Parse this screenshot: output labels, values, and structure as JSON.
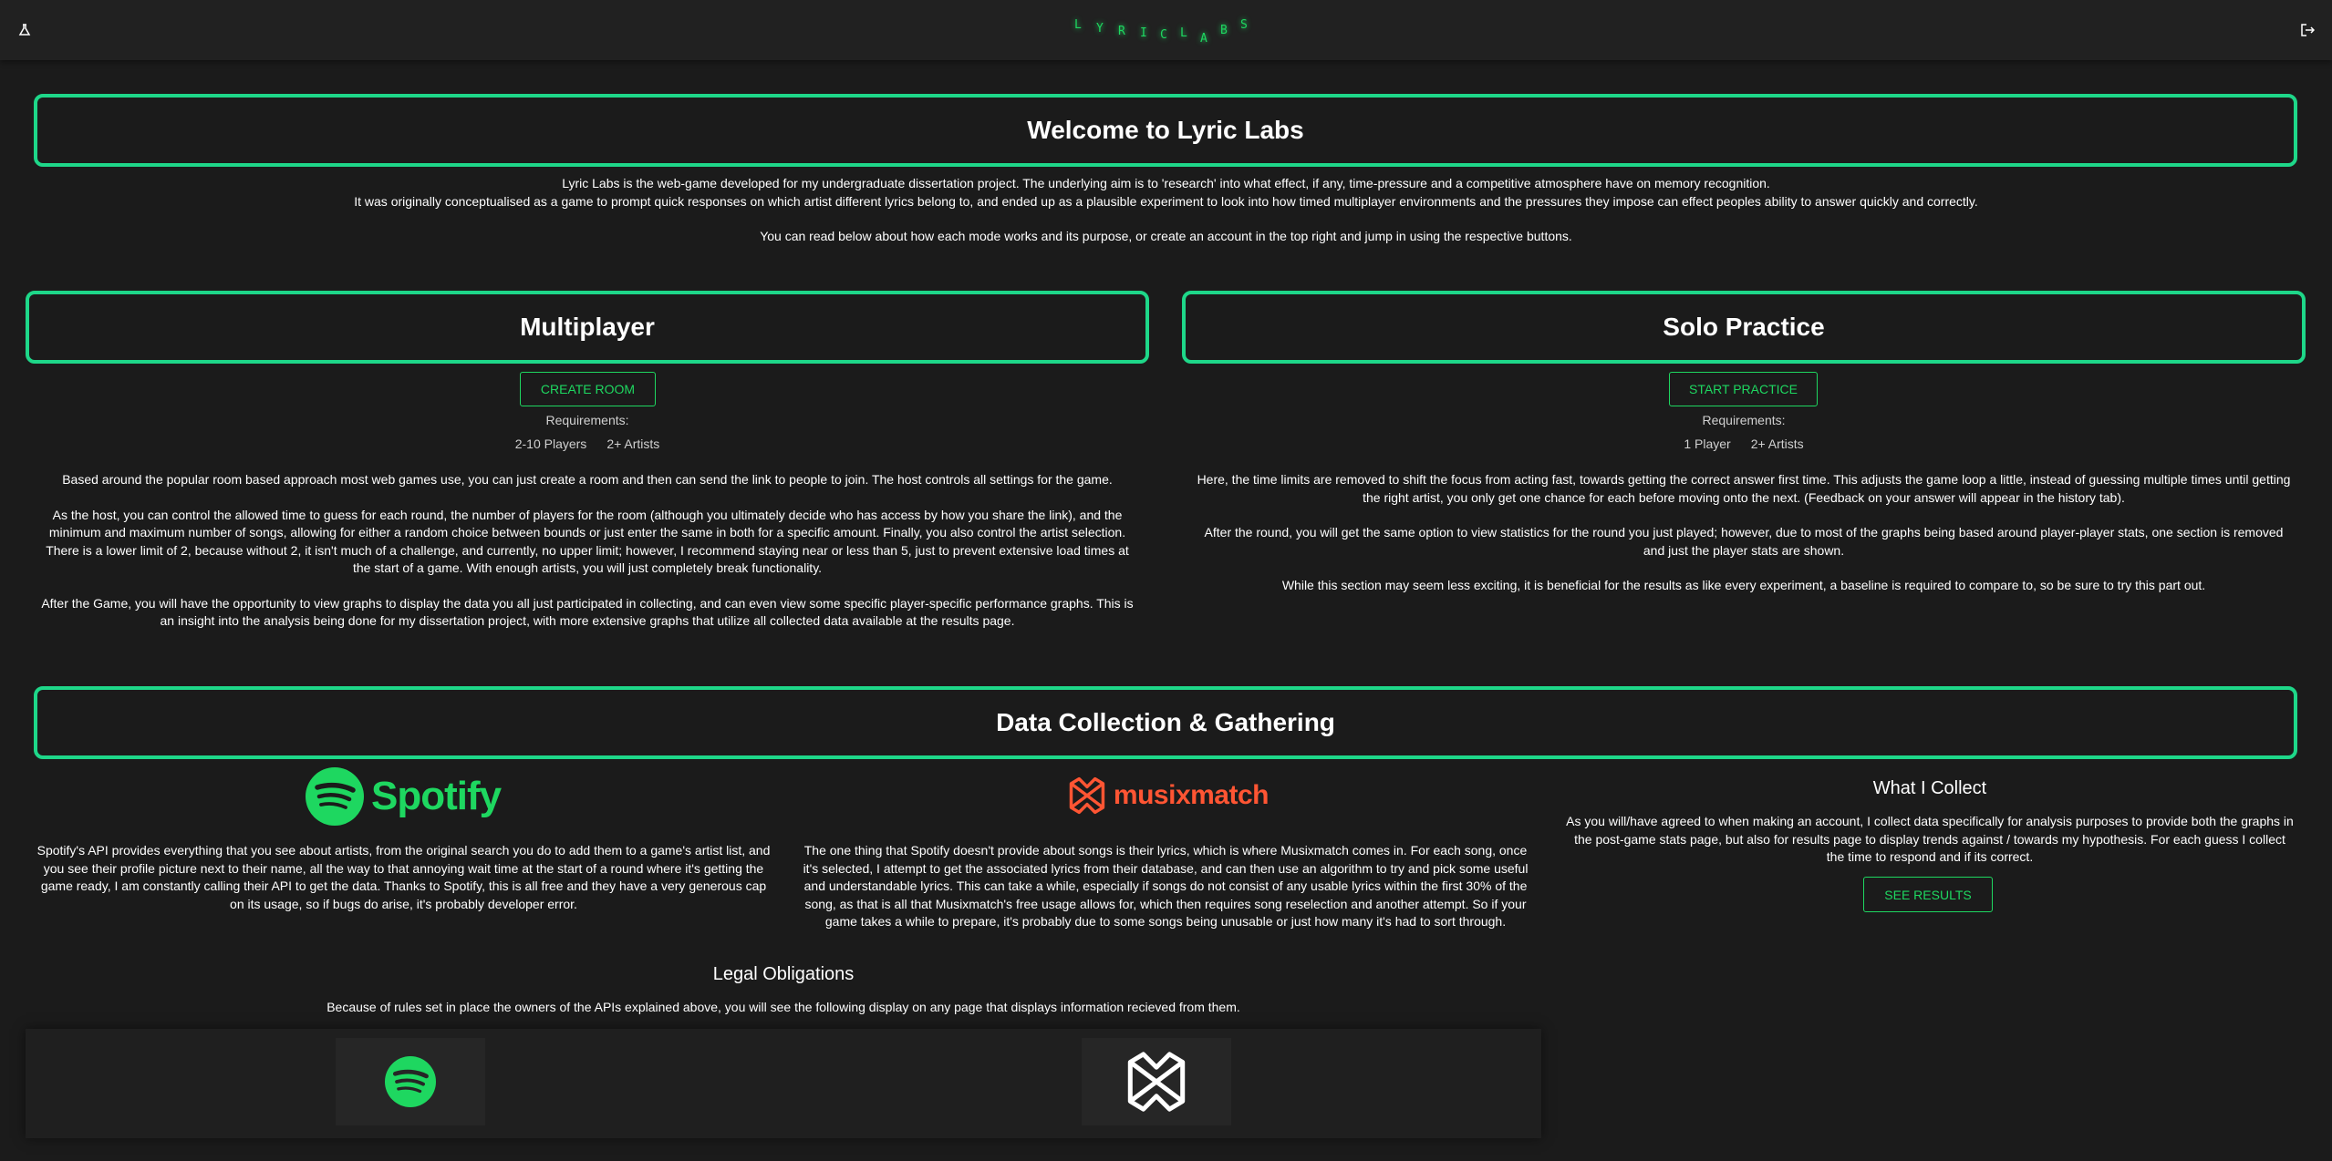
{
  "header": {
    "logo_letters": [
      "L",
      "Y",
      "R",
      "I",
      "C",
      "L",
      "A",
      "B",
      "S"
    ],
    "left_icon": "flask-icon",
    "right_icon": "logout-icon"
  },
  "welcome": {
    "title": "Welcome to Lyric Labs",
    "lines": [
      "Lyric Labs is the web-game developed for my undergraduate dissertation project. The underlying aim is to 'research' into what effect, if any, time-pressure and a competitive atmosphere have on memory recognition.",
      "It was originally conceptualised as a game to prompt quick responses on which artist different lyrics belong to, and ended up as a plausible experiment to look into how timed multiplayer environments and the pressures they impose can effect peoples ability to answer quickly and correctly.",
      "You can read below about how each mode works and its purpose, or create an account in the top right and jump in using the respective buttons."
    ]
  },
  "multiplayer": {
    "title": "Multiplayer",
    "button": "CREATE ROOM",
    "requirements_label": "Requirements:",
    "req_players": "2-10 Players",
    "req_artists": "2+ Artists",
    "paragraphs": [
      "Based around the popular room based approach most web games use, you can just create a room and then can send the link to people to join. The host controls all settings for the game.",
      "As the host, you can control the allowed time to guess for each round, the number of players for the room (although you ultimately decide who has access by how you share the link), and the minimum and maximum number of songs, allowing for either a random choice between bounds or just enter the same in both for a specific amount. Finally, you also control the artist selection. There is a lower limit of 2, because without 2, it isn't much of a challenge, and currently, no upper limit; however, I recommend staying near or less than 5, just to prevent extensive load times at the start of a game. With enough artists, you will just completely break functionality.",
      "After the Game, you will have the opportunity to view graphs to display the data you all just participated in collecting, and can even view some specific player-specific performance graphs. This is an insight into the analysis being done for my dissertation project, with more extensive graphs that utilize all collected data available at the results page."
    ]
  },
  "solo": {
    "title": "Solo Practice",
    "button": "START PRACTICE",
    "requirements_label": "Requirements:",
    "req_players": "1 Player",
    "req_artists": "2+ Artists",
    "paragraphs": [
      "Here, the time limits are removed to shift the focus from acting fast, towards getting the correct answer first time. This adjusts the game loop a little, instead of guessing multiple times until getting the right artist, you only get one chance for each before moving onto the next. (Feedback on your answer will appear in the history tab).",
      "After the round, you will get the same option to view statistics for the round you just played; however, due to most of the graphs being based around player-player stats, one section is removed and just the player stats are shown.",
      "While this section may seem less exciting, it is beneficial for the results as like every experiment, a baseline is required to compare to, so be sure to try this part out."
    ]
  },
  "data_collection": {
    "title": "Data Collection & Gathering",
    "spotify_logo_text": "Spotify",
    "spotify_text": "Spotify's API provides everything that you see about artists, from the original search you do to add them to a game's artist list, and you see their profile picture next to their name, all the way to that annoying wait time at the start of a round where it's getting the game ready, I am constantly calling their API to get the data. Thanks to Spotify, this is all free and they have a very generous cap on its usage, so if bugs do arise, it's probably developer error.",
    "musixmatch_logo_text": "musixmatch",
    "musixmatch_text": "The one thing that Spotify doesn't provide about songs is their lyrics, which is where Musixmatch comes in. For each song, once it's selected, I attempt to get the associated lyrics from their database, and can then use an algorithm to try and pick some useful and understandable lyrics. This can take a while, especially if songs do not consist of any usable lyrics within the first 30% of the song, as that is all that Musixmatch's free usage allows for, which then requires song reselection and another attempt. So if your game takes a while to prepare, it's probably due to some songs being unusable or just how many it's had to sort through.",
    "collect_title": "What I Collect",
    "collect_text": "As you will/have agreed to when making an account, I collect data specifically for analysis purposes to provide both the graphs in the post-game stats page, but also for results page to display trends against / towards my hypothesis. For each guess I collect the time to respond and if its correct.",
    "results_button": "SEE RESULTS"
  },
  "legal": {
    "title": "Legal Obligations",
    "text": "Because of rules set in place the owners of the APIs explained above, you will see the following display on any page that displays information recieved from them."
  },
  "colors": {
    "accent": "#1ed789",
    "spotify_green": "#1ed760",
    "musixmatch_orange": "#ff5533",
    "background": "#1b1b1b"
  }
}
